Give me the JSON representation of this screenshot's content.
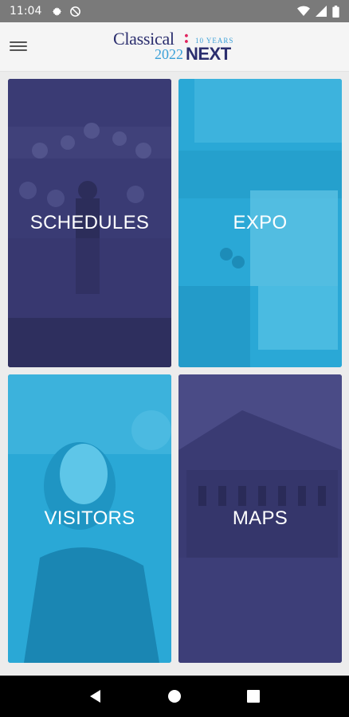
{
  "status_bar": {
    "time": "11:04",
    "left_icons": [
      "gear-icon",
      "no-disturb-icon"
    ],
    "right_icons": [
      "wifi-icon",
      "signal-icon",
      "battery-icon"
    ]
  },
  "app_bar": {
    "logo": {
      "brand": "Classical",
      "colon": ":",
      "years": "10 YEARS",
      "year": "2022",
      "next": "NEXT"
    }
  },
  "tiles": [
    {
      "label": "SCHEDULES",
      "color": "#3e3f7a"
    },
    {
      "label": "EXPO",
      "color": "#2aa8d6"
    },
    {
      "label": "VISITORS",
      "color": "#2aa8d6"
    },
    {
      "label": "MAPS",
      "color": "#3e3f7a"
    }
  ],
  "nav_bar": {
    "buttons": [
      "back-icon",
      "home-icon",
      "recents-icon"
    ]
  }
}
